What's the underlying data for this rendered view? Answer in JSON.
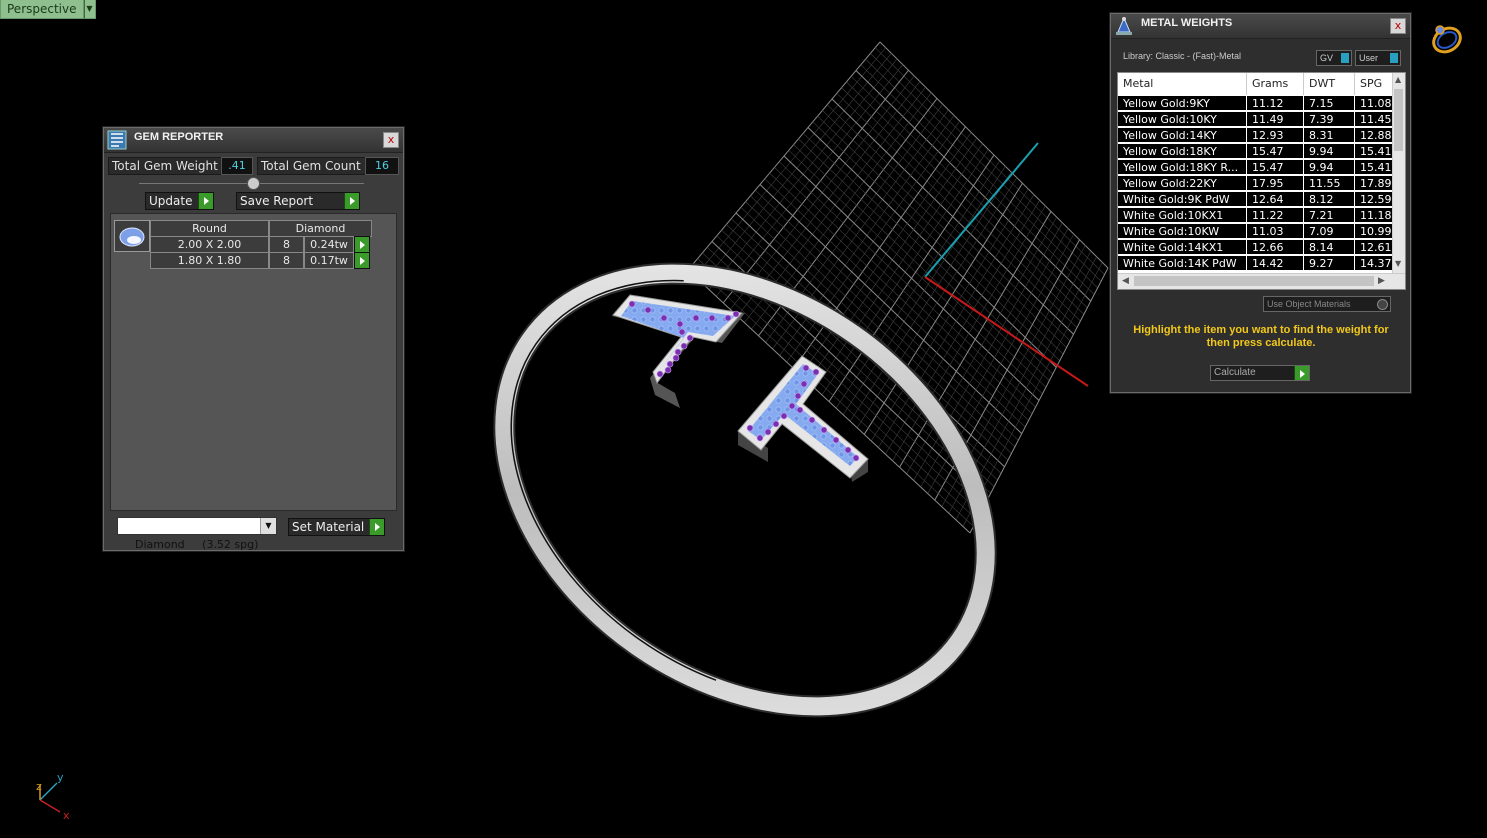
{
  "viewport": {
    "name": "Perspective",
    "dropdown_glyph": "▼"
  },
  "axes": {
    "z": "z",
    "y": "y",
    "x": "x"
  },
  "gem_reporter": {
    "title": "GEM REPORTER",
    "close_glyph": "x",
    "total_weight_label": "Total Gem Weight",
    "total_weight_value": ".41",
    "total_count_label": "Total Gem Count",
    "total_count_value": "16",
    "update_label": "Update",
    "save_report_label": "Save Report",
    "table_header": {
      "shape": "Round",
      "material": "Diamond"
    },
    "rows": [
      {
        "size": "2.00 X 2.00",
        "count": "8",
        "weight": "0.24tw"
      },
      {
        "size": "1.80 X 1.80",
        "count": "8",
        "weight": "0.17tw"
      }
    ],
    "material_select": "Diamond     (3.52 spg)",
    "set_material_label": "Set Material"
  },
  "metal_weights": {
    "title": "METAL WEIGHTS",
    "close_glyph": "x",
    "library": "Library: Classic - (Fast)-Metal",
    "gv_label": "GV",
    "user_label": "User",
    "columns": [
      "Metal",
      "Grams",
      "DWT",
      "SPG"
    ],
    "rows": [
      [
        "Yellow Gold:9KY",
        "11.12",
        "7.15",
        "11.08"
      ],
      [
        "Yellow Gold:10KY",
        "11.49",
        "7.39",
        "11.45"
      ],
      [
        "Yellow Gold:14KY",
        "12.93",
        "8.31",
        "12.88"
      ],
      [
        "Yellow Gold:18KY",
        "15.47",
        "9.94",
        "15.41"
      ],
      [
        "Yellow Gold:18KY R...",
        "15.47",
        "9.94",
        "15.41"
      ],
      [
        "Yellow Gold:22KY",
        "17.95",
        "11.55",
        "17.89"
      ],
      [
        "White Gold:9K PdW",
        "12.64",
        "8.12",
        "12.59"
      ],
      [
        "White Gold:10KX1",
        "11.22",
        "7.21",
        "11.18"
      ],
      [
        "White Gold:10KW",
        "11.03",
        "7.09",
        "10.99"
      ],
      [
        "White Gold:14KX1",
        "12.66",
        "8.14",
        "12.61"
      ],
      [
        "White Gold:14K PdW",
        "14.42",
        "9.27",
        "14.37"
      ]
    ],
    "use_object_materials": "Use Object Materials",
    "hint": "Highlight the item you want to find the weight for then press calculate.",
    "calculate_label": "Calculate"
  },
  "colors": {
    "grid": "#6a6a6a",
    "axis_x": "#c81818",
    "axis_y": "#1aa0b0",
    "gem": "#7fa6f0",
    "prong": "#7a2fb0",
    "metal": "#d8d8d8"
  },
  "icons": [
    "viewport-dropdown-icon",
    "gem-reporter-icon",
    "metal-weights-icon",
    "ring-icon",
    "axis-gizmo-icon"
  ]
}
